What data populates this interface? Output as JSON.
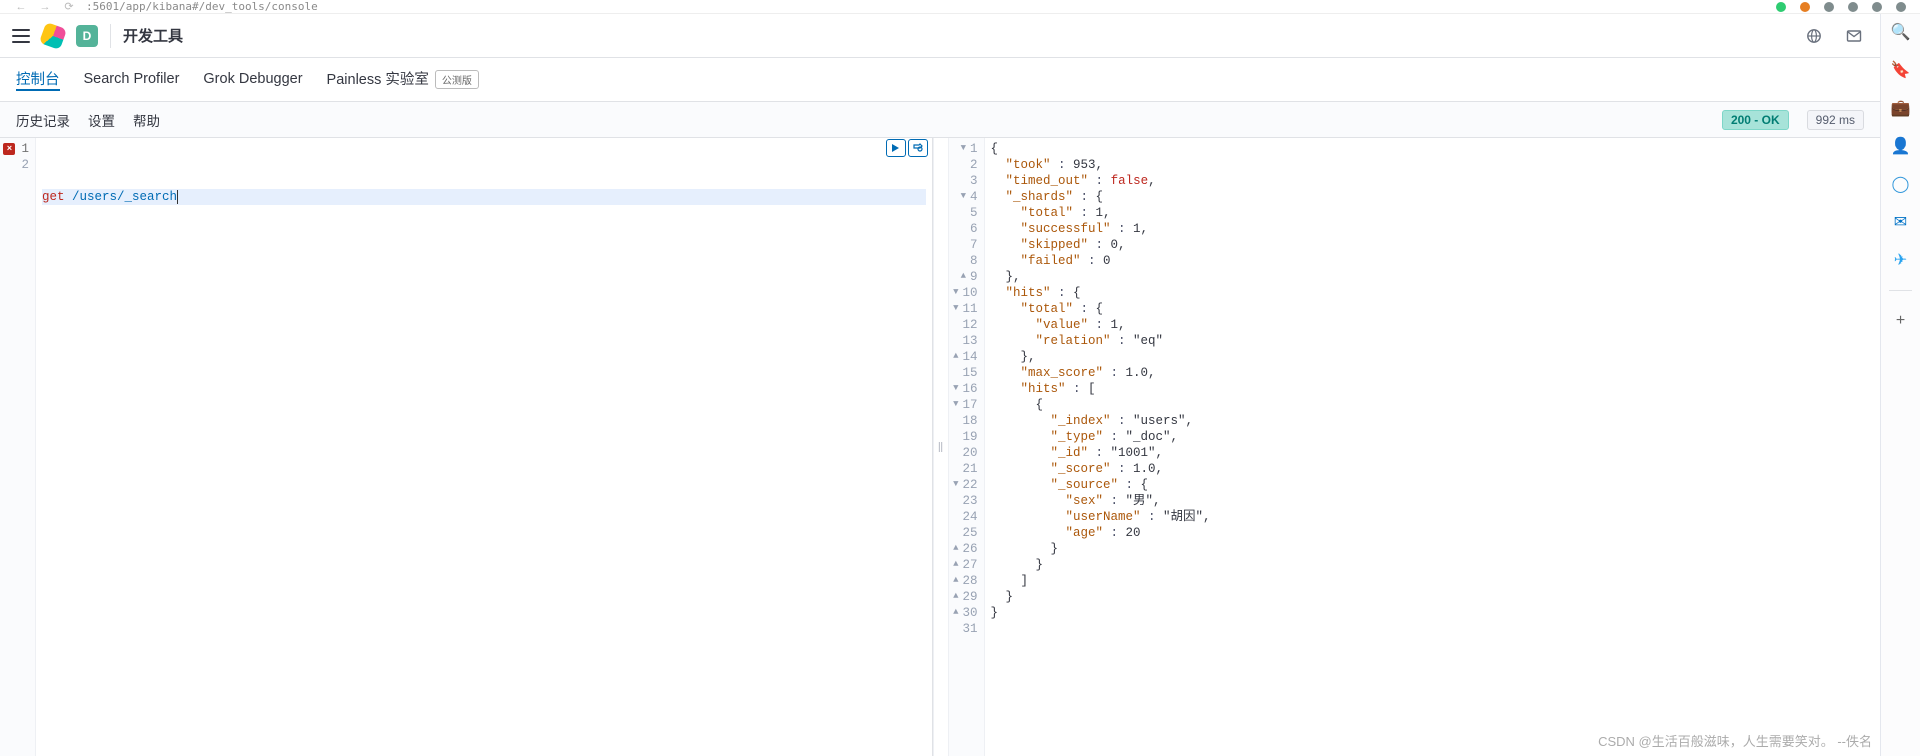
{
  "browser": {
    "url_visible": ":5601/app/kibana#/dev_tools/console",
    "right_dots": [
      "#2ecc71",
      "#e67e22",
      "#7f8c8d",
      "#7f8c8d",
      "#7f8c8d",
      "#7f8c8d"
    ]
  },
  "header": {
    "space_letter": "D",
    "breadcrumb": "开发工具"
  },
  "tabs": [
    {
      "id": "console",
      "label": "控制台",
      "active": true
    },
    {
      "id": "profiler",
      "label": "Search Profiler",
      "active": false
    },
    {
      "id": "grok",
      "label": "Grok Debugger",
      "active": false
    },
    {
      "id": "painless",
      "label": "Painless 实验室",
      "active": false,
      "badge": "公测版"
    }
  ],
  "sec_toolbar": {
    "links": [
      "历史记录",
      "设置",
      "帮助"
    ],
    "status": "200 - OK",
    "time": "992 ms"
  },
  "request": {
    "lines": [
      {
        "n": 1,
        "error": true,
        "tokens": [
          {
            "cls": "kw",
            "t": "get"
          },
          {
            "cls": "",
            "t": " "
          },
          {
            "cls": "path",
            "t": "/users/_search"
          }
        ],
        "hl": true,
        "cursor": true
      },
      {
        "n": 2,
        "tokens": []
      }
    ]
  },
  "response": {
    "lines": [
      {
        "n": 1,
        "fold": "▼",
        "raw": "{"
      },
      {
        "n": 2,
        "raw": "  \"took\" : 953,"
      },
      {
        "n": 3,
        "raw": "  \"timed_out\" : false,"
      },
      {
        "n": 4,
        "fold": "▼",
        "raw": "  \"_shards\" : {"
      },
      {
        "n": 5,
        "raw": "    \"total\" : 1,"
      },
      {
        "n": 6,
        "raw": "    \"successful\" : 1,"
      },
      {
        "n": 7,
        "raw": "    \"skipped\" : 0,"
      },
      {
        "n": 8,
        "raw": "    \"failed\" : 0"
      },
      {
        "n": 9,
        "fold": "▲",
        "raw": "  },"
      },
      {
        "n": 10,
        "fold": "▼",
        "raw": "  \"hits\" : {"
      },
      {
        "n": 11,
        "fold": "▼",
        "raw": "    \"total\" : {"
      },
      {
        "n": 12,
        "raw": "      \"value\" : 1,"
      },
      {
        "n": 13,
        "raw": "      \"relation\" : \"eq\""
      },
      {
        "n": 14,
        "fold": "▲",
        "raw": "    },"
      },
      {
        "n": 15,
        "raw": "    \"max_score\" : 1.0,"
      },
      {
        "n": 16,
        "fold": "▼",
        "raw": "    \"hits\" : ["
      },
      {
        "n": 17,
        "fold": "▼",
        "raw": "      {"
      },
      {
        "n": 18,
        "raw": "        \"_index\" : \"users\","
      },
      {
        "n": 19,
        "raw": "        \"_type\" : \"_doc\","
      },
      {
        "n": 20,
        "raw": "        \"_id\" : \"1001\","
      },
      {
        "n": 21,
        "raw": "        \"_score\" : 1.0,"
      },
      {
        "n": 22,
        "fold": "▼",
        "raw": "        \"_source\" : {"
      },
      {
        "n": 23,
        "raw": "          \"sex\" : \"男\","
      },
      {
        "n": 24,
        "raw": "          \"userName\" : \"胡因\","
      },
      {
        "n": 25,
        "raw": "          \"age\" : 20"
      },
      {
        "n": 26,
        "fold": "▲",
        "raw": "        }"
      },
      {
        "n": 27,
        "fold": "▲",
        "raw": "      }"
      },
      {
        "n": 28,
        "fold": "▲",
        "raw": "    ]"
      },
      {
        "n": 29,
        "fold": "▲",
        "raw": "  }"
      },
      {
        "n": 30,
        "fold": "▲",
        "raw": "}"
      },
      {
        "n": 31,
        "raw": ""
      }
    ]
  },
  "rail_icons": [
    {
      "name": "search-icon",
      "glyph": "🔍",
      "color": "#4a90d9"
    },
    {
      "name": "bookmark-icon",
      "glyph": "🔖",
      "color": "#e67e22"
    },
    {
      "name": "briefcase-icon",
      "glyph": "💼",
      "color": "#c0392b"
    },
    {
      "name": "person-icon",
      "glyph": "👤",
      "color": "#8e44ad"
    },
    {
      "name": "circle-icon",
      "glyph": "◯",
      "color": "#3498db"
    },
    {
      "name": "mail-app-icon",
      "glyph": "✉",
      "color": "#0072c6"
    },
    {
      "name": "send-icon",
      "glyph": "✈",
      "color": "#2aa3ef"
    }
  ],
  "rail_plus": "+",
  "watermark": "CSDN @生活百般滋味，人生需要笑对。 --佚名"
}
